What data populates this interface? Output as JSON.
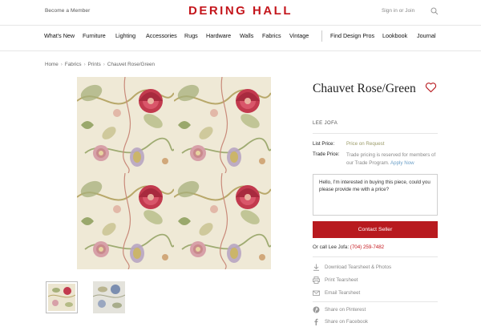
{
  "header": {
    "become_member": "Become a Member",
    "logo": "DERING HALL",
    "sign_in": "Sign in",
    "or": "or",
    "join": "Join"
  },
  "nav": {
    "items": [
      "What's New",
      "Furniture",
      "Lighting",
      "Accessories",
      "Rugs",
      "Hardware",
      "Walls",
      "Fabrics",
      "Vintage",
      "Find Design Pros",
      "Lookbook",
      "Journal"
    ]
  },
  "breadcrumb": [
    "Home",
    "Fabrics",
    "Prints",
    "Chauvet Rose/Green"
  ],
  "product": {
    "title": "Chauvet Rose/Green",
    "brand": "LEE JOFA",
    "list_price_label": "List Price:",
    "list_price_value": "Price on Request",
    "trade_price_label": "Trade Price:",
    "trade_price_text": "Trade pricing is reserved for members of our Trade Program.",
    "apply_now": "Apply Now",
    "message": "Hello, I'm interested in buying this piece, could you please provide me with a price?",
    "contact_label": "Contact Seller",
    "or_call": "Or call Lee Jofa:",
    "phone": "(704) 259-7482"
  },
  "actions": {
    "download": "Download Tearsheet & Photos",
    "print": "Print Tearsheet",
    "email": "Email Tearsheet",
    "pinterest": "Share on Pinterest",
    "facebook": "Share on Facebook"
  },
  "colors": {
    "brand_red": "#c4161c",
    "button_red": "#b81a1f"
  }
}
